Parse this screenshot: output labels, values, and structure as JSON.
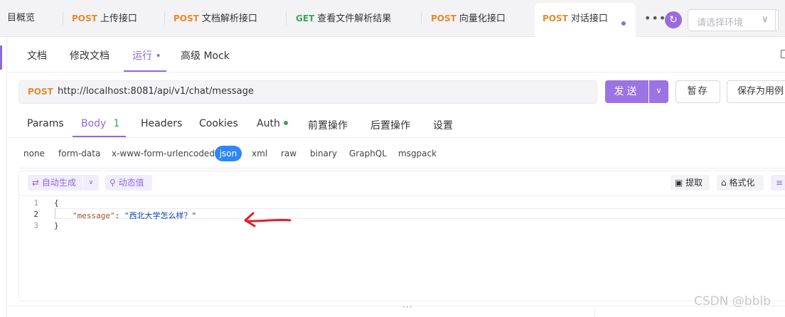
{
  "tabs": [
    {
      "method": "",
      "label": "目概览"
    },
    {
      "method": "POST",
      "label": "上传接口"
    },
    {
      "method": "POST",
      "label": "文档解析接口"
    },
    {
      "method": "GET",
      "label": "查看文件解析结果"
    },
    {
      "method": "POST",
      "label": "向量化接口"
    },
    {
      "method": "POST",
      "label": "对话接口"
    }
  ],
  "env": {
    "placeholder": "请选择环境"
  },
  "subtabs": [
    "文档",
    "修改文档",
    "运行 •",
    "高级 Mock"
  ],
  "request": {
    "method": "POST",
    "url": "http://localhost:8081/api/v1/chat/message",
    "send_label": "发送",
    "save_label": "暂存",
    "save_as_label": "保存为用例"
  },
  "param_tabs": [
    {
      "label": "Params"
    },
    {
      "label": "Body",
      "count": "1"
    },
    {
      "label": "Headers"
    },
    {
      "label": "Cookies"
    },
    {
      "label": "Auth"
    },
    {
      "label": "前置操作"
    },
    {
      "label": "后置操作"
    },
    {
      "label": "设置"
    }
  ],
  "body_types": [
    "none",
    "form-data",
    "x-www-form-urlencoded",
    "json",
    "xml",
    "raw",
    "binary",
    "GraphQL",
    "msgpack"
  ],
  "editor_toolbar": {
    "auto_generate": "自动生成",
    "dynamic_value": "动态值",
    "extract": "提取",
    "format": "格式化"
  },
  "code": {
    "line_numbers": [
      "1",
      "2",
      "3"
    ],
    "open_brace": "{",
    "key": "\"message\"",
    "colon": ": ",
    "value": "\"西北大学怎么样？\"",
    "close_brace": "}"
  },
  "resize_handle": "···",
  "watermark": "CSDN @bblb",
  "colors": {
    "accent": "#8c6ae0",
    "post": "#e8882a",
    "get": "#3aa55a",
    "json_active": "#2f86f6",
    "annotation_arrow": "#e0202a"
  }
}
